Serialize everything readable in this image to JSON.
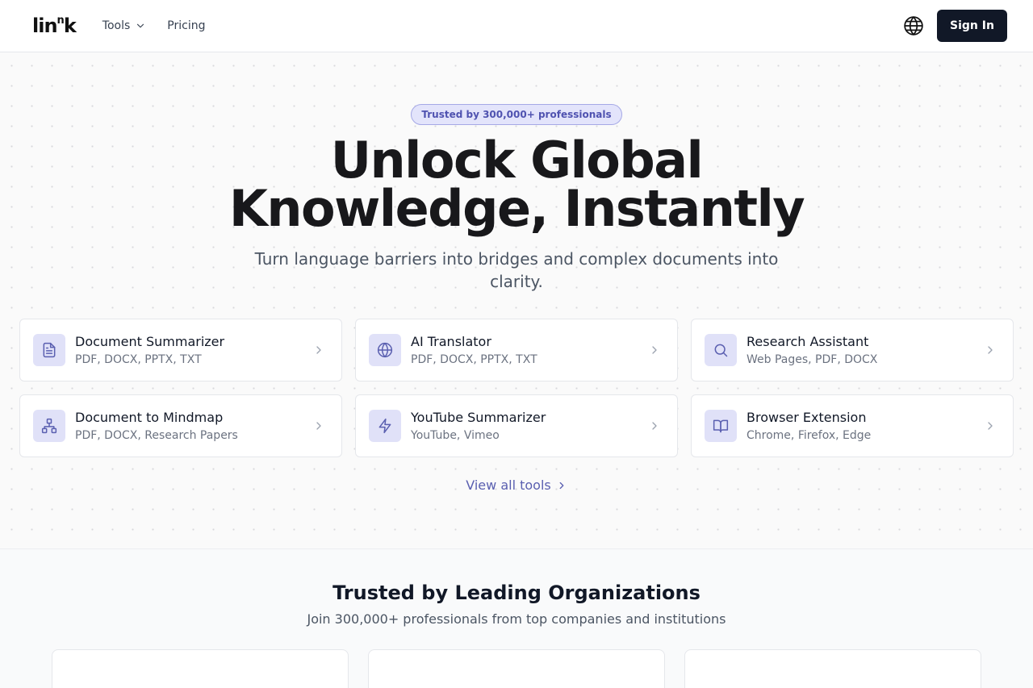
{
  "header": {
    "logo": {
      "base": "lin",
      "sup": "n",
      "end": "k"
    },
    "nav": [
      {
        "label": "Tools",
        "has_dropdown": true
      },
      {
        "label": "Pricing",
        "has_dropdown": false
      }
    ],
    "language_icon": "globe-icon",
    "sign_in_label": "Sign In"
  },
  "hero": {
    "badge": "Trusted by 300,000+ professionals",
    "title_line1": "Unlock Global",
    "title_line2": "Knowledge, Instantly",
    "subtitle": "Turn language barriers into bridges and complex documents into clarity.",
    "tools": [
      {
        "icon": "document-icon",
        "title": "Document Summarizer",
        "formats": "PDF, DOCX, PPTX, TXT"
      },
      {
        "icon": "globe-icon",
        "title": "AI Translator",
        "formats": "PDF, DOCX, PPTX, TXT"
      },
      {
        "icon": "search-icon",
        "title": "Research Assistant",
        "formats": "Web Pages, PDF, DOCX"
      },
      {
        "icon": "mindmap-icon",
        "title": "Document to Mindmap",
        "formats": "PDF, DOCX, Research Papers"
      },
      {
        "icon": "lightning-icon",
        "title": "YouTube Summarizer",
        "formats": "YouTube, Vimeo"
      },
      {
        "icon": "book-icon",
        "title": "Browser Extension",
        "formats": "Chrome, Firefox, Edge"
      }
    ],
    "view_all": "View all tools"
  },
  "trusted": {
    "title": "Trusted by Leading Organizations",
    "subtitle": "Join 300,000+ professionals from top companies and institutions"
  },
  "colors": {
    "accent": "#5a5fb0",
    "icon_bg": "#e0e1f8",
    "button_dark": "#111827"
  }
}
